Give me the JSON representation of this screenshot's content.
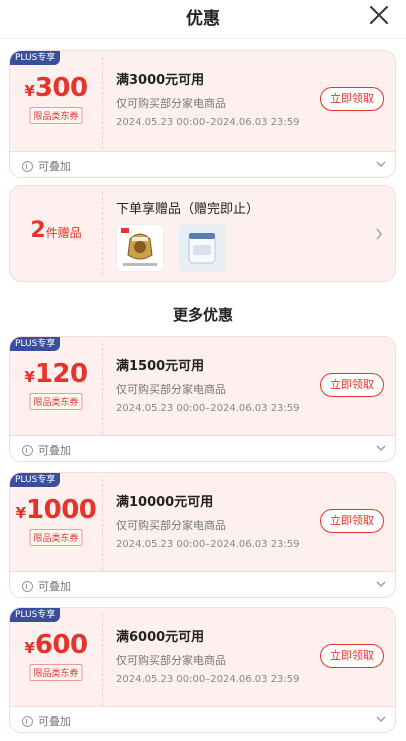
{
  "header": {
    "title": "优惠"
  },
  "coupons_top": [
    {
      "plus": "PLUS专享",
      "currency": "¥",
      "amount": "300",
      "limit": "限品类东券",
      "condition": "满3000元可用",
      "scope": "仅可购买部分家电商品",
      "validity": "2024.05.23 00:00–2024.06.03 23:59",
      "claim": "立即领取",
      "stack": "可叠加"
    }
  ],
  "gift": {
    "count": "2",
    "unit": "件赠品",
    "title": "下单享赠品（赠完即止）"
  },
  "more_title": "更多优惠",
  "coupons_more": [
    {
      "plus": "PLUS专享",
      "currency": "¥",
      "amount": "120",
      "limit": "限品类东券",
      "condition": "满1500元可用",
      "scope": "仅可购买部分家电商品",
      "validity": "2024.05.23 00:00–2024.06.03 23:59",
      "claim": "立即领取",
      "stack": "可叠加"
    },
    {
      "plus": "PLUS专享",
      "currency": "¥",
      "amount": "1000",
      "limit": "限品类东券",
      "condition": "满10000元可用",
      "scope": "仅可购买部分家电商品",
      "validity": "2024.05.23 00:00–2024.06.03 23:59",
      "claim": "立即领取",
      "stack": "可叠加"
    },
    {
      "plus": "PLUS专享",
      "currency": "¥",
      "amount": "600",
      "limit": "限品类东券",
      "condition": "满6000元可用",
      "scope": "仅可购买部分家电商品",
      "validity": "2024.05.23 00:00–2024.06.03 23:59",
      "claim": "立即领取",
      "stack": "可叠加"
    }
  ],
  "colors": {
    "accent": "#e4342b",
    "plus": "#3a4e9e",
    "card_bg": "#fdf0ee"
  }
}
